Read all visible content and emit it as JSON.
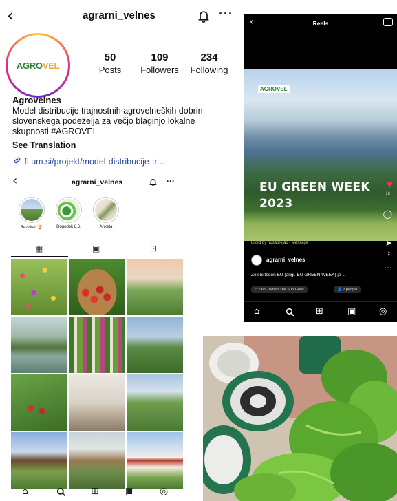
{
  "colors": {
    "link": "#2b4f9e",
    "heart": "#ff2d55",
    "brand_green": "#2e7d32",
    "brand_yellow": "#f9a825"
  },
  "profile": {
    "username": "agrarni_velnes",
    "logo": {
      "prefix": "AGRO",
      "highlight": "VEL"
    },
    "stats": [
      {
        "value": "50",
        "label": "Posts"
      },
      {
        "value": "109",
        "label": "Followers"
      },
      {
        "value": "234",
        "label": "Following"
      }
    ],
    "name": "Agrovelnes",
    "bio": "Model distribucije trajnostnih agrovelneških dobrin slovenskega podeželja za večjo blaginjo lokalne skupnosti #AGROVEL",
    "see_translation": "See Translation",
    "link": "fl.um.si/projekt/model-distribucije-tr..."
  },
  "mini_profile": {
    "username": "agrarni_velnes",
    "highlights": [
      {
        "label": "Rezultati 🏆"
      },
      {
        "label": "Dogodek 8.6."
      },
      {
        "label": "Anketa"
      }
    ]
  },
  "icons": {
    "back": "chevron-left-icon",
    "notifications": "bell-icon",
    "more": "ellipsis-icon",
    "link": "link-icon",
    "grid_tab": "grid-icon",
    "reels_tab": "reels-icon",
    "tagged_tab": "tagged-icon",
    "home": "home-icon",
    "search": "search-icon",
    "create": "plus-square-icon",
    "reels": "reels-icon",
    "profile": "profile-icon",
    "heart": "heart-icon",
    "comment": "comment-icon",
    "share": "send-icon",
    "camera": "camera-icon"
  },
  "reels": {
    "title": "Reels",
    "logo": "AGROVEL",
    "headline_line1": "EU GREEN WEEK",
    "headline_line2": "2023",
    "liked_by": "Liked by nusaprejac · Message",
    "username": "agrarni_velnes",
    "caption": "Zeleni teden EU (angl. EU GREEN WEEK) je ...",
    "audio_chip": "♫ calo · When The Sun Goes",
    "people_chip": "👤 2 people",
    "likes_count": "16",
    "comments_count": "1",
    "shares_count": "2"
  }
}
